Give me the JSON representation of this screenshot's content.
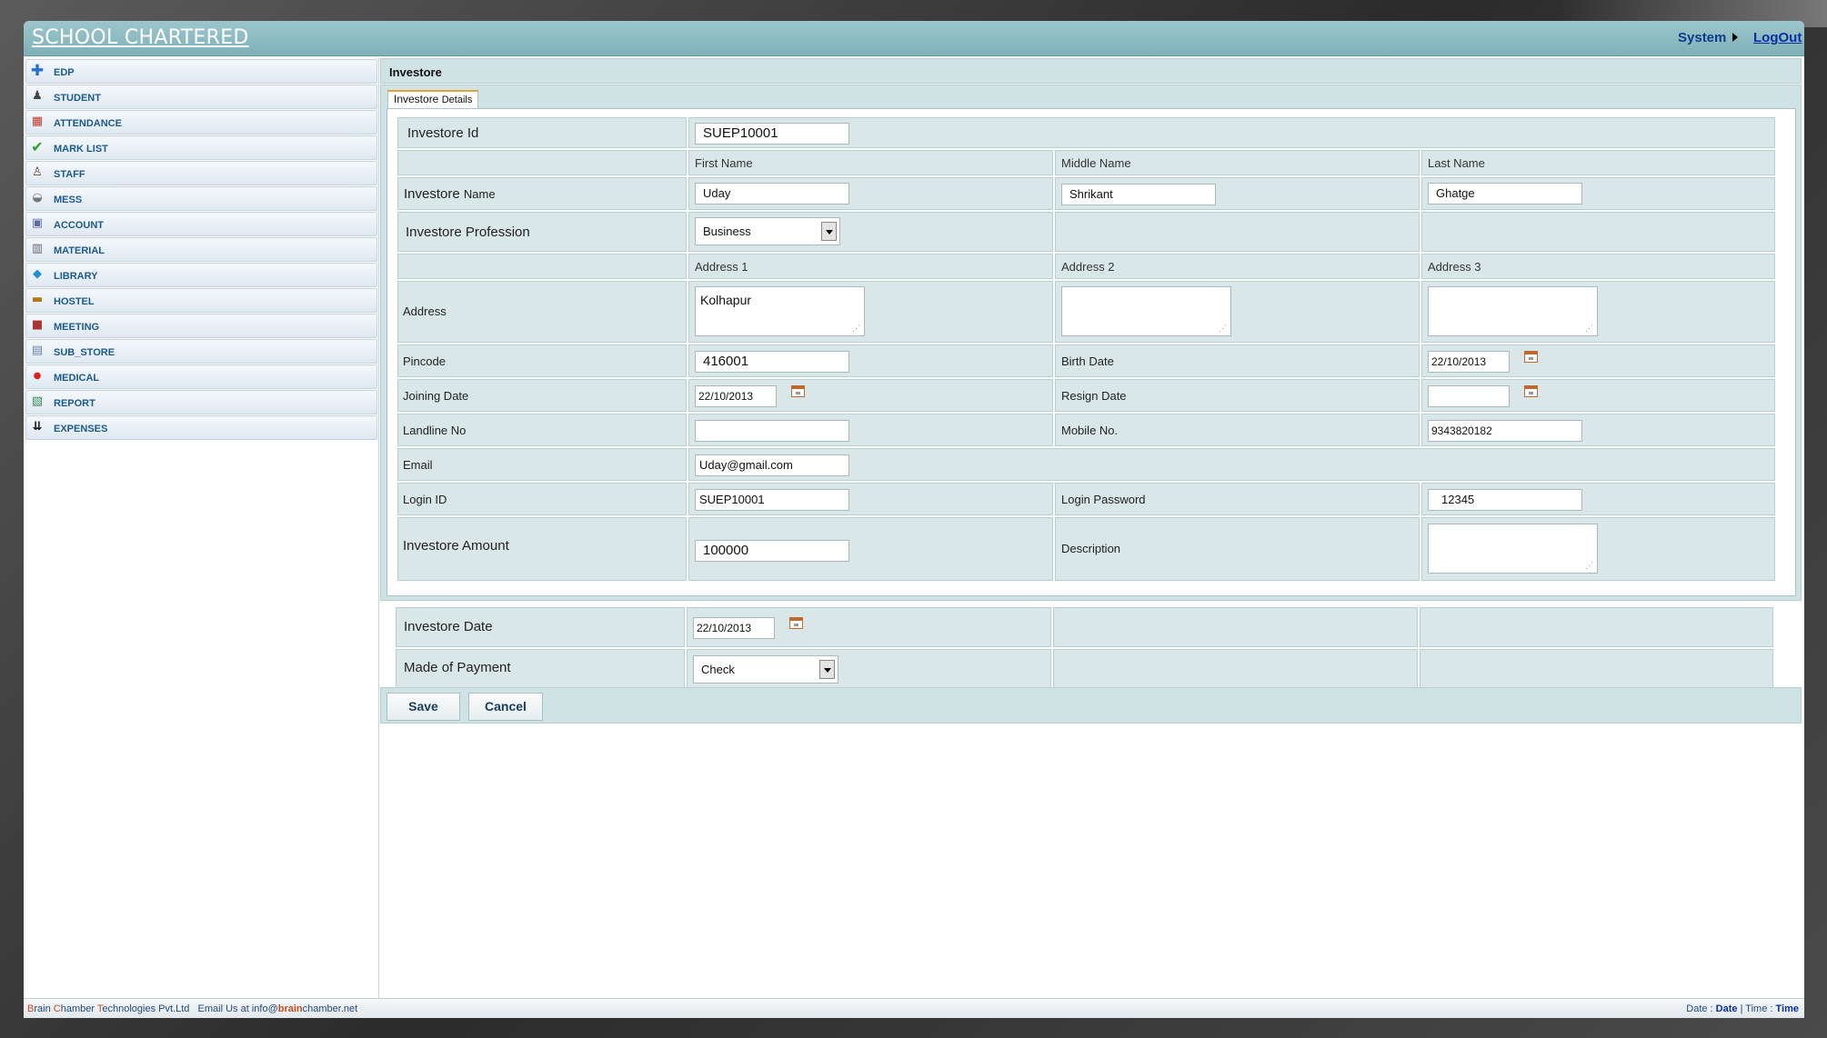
{
  "header": {
    "brand": "SCHOOL CHARTERED",
    "system_label": "System",
    "logout_label": "LogOut"
  },
  "sidebar": {
    "items": [
      {
        "label": "EDP",
        "icon": "plus-icon"
      },
      {
        "label": "STUDENT",
        "icon": "student-icon"
      },
      {
        "label": "ATTENDANCE",
        "icon": "calendar-icon"
      },
      {
        "label": "MARK LIST",
        "icon": "checkmark-icon"
      },
      {
        "label": "STAFF",
        "icon": "person-icon"
      },
      {
        "label": "MESS",
        "icon": "dish-icon"
      },
      {
        "label": "ACCOUNT",
        "icon": "account-icon"
      },
      {
        "label": "MATERIAL",
        "icon": "material-icon"
      },
      {
        "label": "LIBRARY",
        "icon": "book-icon"
      },
      {
        "label": "HOSTEL",
        "icon": "bed-icon"
      },
      {
        "label": "MEETING",
        "icon": "meeting-icon"
      },
      {
        "label": "SUB_STORE",
        "icon": "store-icon"
      },
      {
        "label": "MEDICAL",
        "icon": "medical-icon"
      },
      {
        "label": "REPORT",
        "icon": "report-icon"
      },
      {
        "label": "EXPENSES",
        "icon": "expenses-icon"
      }
    ]
  },
  "main": {
    "section_title": "Investore",
    "tab_label_main": "Investore",
    "tab_label_sub": "Details",
    "form": {
      "investore_id_label": "Investore Id",
      "investore_id_value": "SUEP10001",
      "first_name_head": "First Name",
      "middle_name_head": "Middle Name",
      "last_name_head": "Last Name",
      "name_label_main": "Investore",
      "name_label_sub": "Name",
      "first_name_value": "Uday",
      "middle_name_value": "Shrikant",
      "last_name_value": "Ghatge",
      "profession_label": "Investore Profession",
      "profession_value": "Business",
      "address1_head": "Address 1",
      "address2_head": "Address 2",
      "address3_head": "Address 3",
      "address_label": "Address",
      "address1_value": "Kolhapur",
      "address2_value": "",
      "address3_value": "",
      "pincode_label": "Pincode",
      "pincode_value": "416001",
      "birth_date_label": "Birth Date",
      "birth_date_value": "22/10/2013",
      "joining_date_label": "Joining Date",
      "joining_date_value": "22/10/2013",
      "resign_date_label": "Resign Date",
      "resign_date_value": "",
      "landline_label": "Landline No",
      "landline_value": "",
      "mobile_label": "Mobile No.",
      "mobile_value": "9343820182",
      "email_label": "Email",
      "email_value": "Uday@gmail.com",
      "login_id_label": "Login ID",
      "login_id_value": "SUEP10001",
      "login_password_label": "Login Password",
      "login_password_value": "12345",
      "amount_label": "Investore Amount",
      "amount_value": "100000",
      "description_label": "Description",
      "description_value": "",
      "investore_date_label": "Investore Date",
      "investore_date_value": "22/10/2013",
      "payment_label": "Made of Payment",
      "payment_value": "Check"
    },
    "save_label": "Save",
    "cancel_label": "Cancel"
  },
  "footer": {
    "company_b": "B",
    "company_rest1": "rain ",
    "company_c": "C",
    "company_rest2": "hamber ",
    "company_t": "T",
    "company_rest3": "echnologies Pvt.Ltd",
    "email_prefix": "Email Us at info@",
    "email_brain": "brain",
    "email_suffix": "chamber.net",
    "date_label": "Date : ",
    "date_value": "Date",
    "separator": " | ",
    "time_label": "Time : ",
    "time_value": "Time"
  },
  "colors": {
    "header": "#86b7bd",
    "panel": "#cfe3e5",
    "cell": "#dae7e8",
    "sidebar_text": "#1d5a8c",
    "tab_accent": "#e5a33a"
  }
}
